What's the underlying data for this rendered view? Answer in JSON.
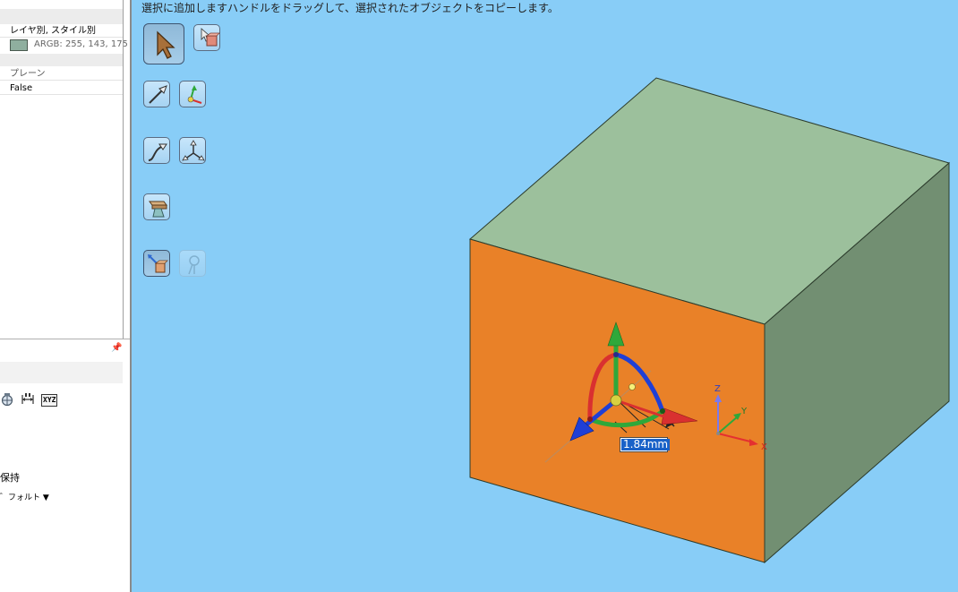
{
  "properties": {
    "layer_style": "レイヤ別, スタイル別",
    "color_argb": "ARGB: 255, 143, 175",
    "surface_label": "プレーン",
    "surface_value": "False"
  },
  "options": {
    "keep_label": "保持",
    "default_label": "゛フォルト ▼",
    "xyz_label": "XYZ"
  },
  "viewport": {
    "hint": "選択に追加しますハンドルをドラッグして、選択されたオブジェクトをコピーします。",
    "dimension_value": "1.84mm"
  },
  "triad": {
    "z": "Z",
    "y": "Y",
    "x": "X"
  },
  "colors": {
    "background": "#88cdf7",
    "box_front": "#e98128",
    "box_top": "#9cc09c",
    "box_side": "#728f72",
    "axis_x": "#d93030",
    "axis_y": "#2fa83a",
    "axis_z": "#1f3fd6",
    "highlight": "#1a62c8"
  }
}
